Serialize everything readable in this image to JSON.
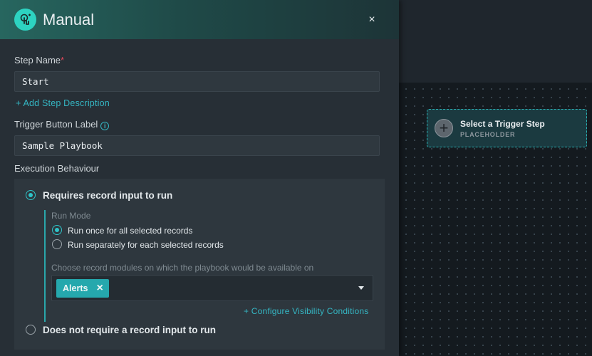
{
  "header": {
    "title": "Manual",
    "icon": "touch-icon",
    "close_glyph": "×"
  },
  "step_name": {
    "label": "Step Name",
    "required_mark": "*",
    "value": "Start"
  },
  "add_description": "+ Add Step Description",
  "trigger_button": {
    "label": "Trigger Button Label",
    "info_glyph": "i",
    "value": "Sample Playbook"
  },
  "execution": {
    "label": "Execution Behaviour",
    "option_requires": "Requires record input to run",
    "run_mode_label": "Run Mode",
    "run_once": "Run once for all selected records",
    "run_separately": "Run separately for each selected records",
    "choose_modules_label": "Choose record modules on which the playbook would be available on",
    "selected_modules": [
      {
        "label": "Alerts",
        "remove_glyph": "×"
      }
    ],
    "configure_link": "+ Configure Visibility Conditions",
    "option_not_requires": "Does not require a record input to run"
  },
  "canvas": {
    "trigger_card": {
      "plus_glyph": "+",
      "title": "Select a Trigger Step",
      "subtitle": "PLACEHOLDER"
    }
  },
  "colors": {
    "accent": "#2ec4c9",
    "header_gradient_start": "#27665f",
    "panel_bg": "#272f36",
    "required": "#e0475a"
  }
}
